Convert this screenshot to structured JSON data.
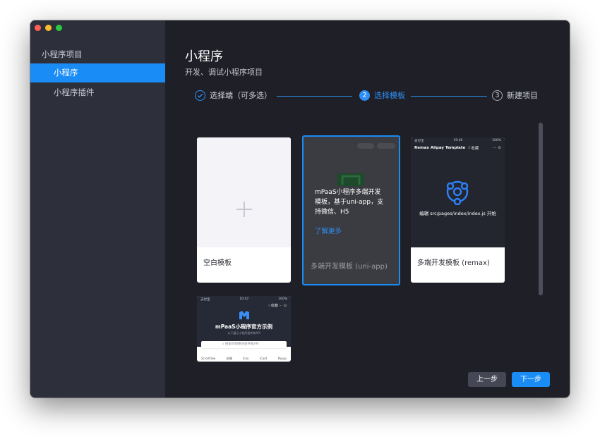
{
  "traffic_lights": {
    "close": "#ff5f57",
    "minimize": "#febc2e",
    "zoom": "#28c840"
  },
  "sidebar": {
    "group_label": "小程序项目",
    "items": [
      {
        "label": "小程序",
        "active": true
      },
      {
        "label": "小程序插件",
        "active": false
      }
    ]
  },
  "header": {
    "title": "小程序",
    "subtitle": "开发、调试小程序项目"
  },
  "steps": [
    {
      "number": "1",
      "label": "选择端（可多选）",
      "state": "done"
    },
    {
      "number": "2",
      "label": "选择模板",
      "state": "current"
    },
    {
      "number": "3",
      "label": "新建项目",
      "state": "todo"
    }
  ],
  "templates": {
    "blank": {
      "label": "空白模板"
    },
    "uni_app": {
      "label": "多端开发模板 (uni-app)",
      "overlay_text": "mPaaS小程序多端开发模板，基于uni-app，支持微信、H5",
      "learn_more": "了解更多"
    },
    "remax": {
      "label": "多端开发模板 (remax)",
      "status_left": "支付宝",
      "status_time": "19:46",
      "status_right": "100%",
      "nav_title": "Remax Alipay Template",
      "nav_fav": "收藏",
      "body_text": "编辑 src/pages/index/index.js 开始"
    },
    "official": {
      "status_left": "支付宝",
      "status_time": "10:47",
      "status_right": "100%",
      "nav_fav": "收藏",
      "title": "mPaaS小程序官方示例",
      "subtitle": "以下展示小程序组件和API",
      "search_placeholder": "搜索你想要的组件和API",
      "tabs": [
        "ScrollView",
        "轮播",
        "Icon",
        "iCard",
        "Popup"
      ]
    }
  },
  "footer": {
    "prev_label": "上一步",
    "next_label": "下一步"
  },
  "colors": {
    "accent": "#1a8cf5",
    "window_bg": "#1f2027",
    "sidebar_bg": "#2d2f3b"
  }
}
